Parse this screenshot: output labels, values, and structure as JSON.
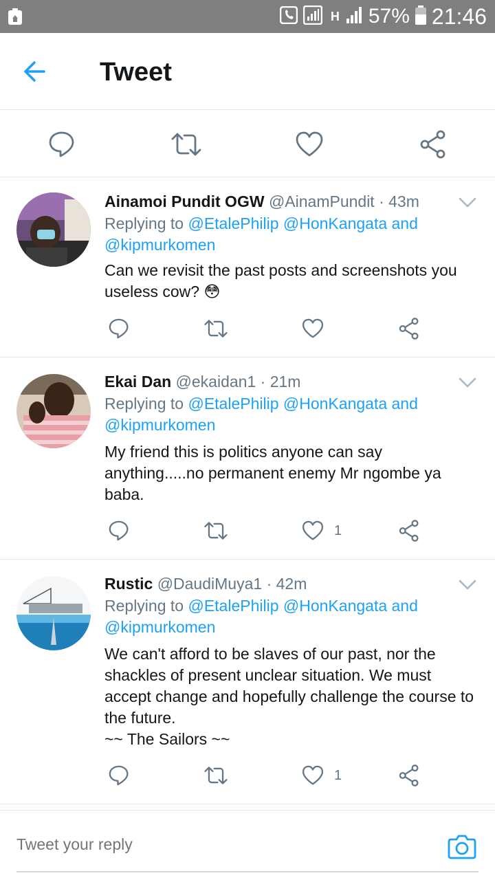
{
  "status_bar": {
    "battery_percent": "57%",
    "time": "21:46",
    "network": "H",
    "icons": [
      "recycle-icon",
      "phone-icon",
      "signal-icon",
      "battery-icon"
    ]
  },
  "header": {
    "title": "Tweet",
    "back_icon": "arrow-left-icon"
  },
  "main_actions": {
    "icons": [
      "reply-icon",
      "retweet-icon",
      "like-icon",
      "share-icon"
    ]
  },
  "replies": [
    {
      "name": "Ainamoi Pundit OGW",
      "handle": "@AinamPundit",
      "time": "· 43m",
      "replying_prefix": "Replying to",
      "mention1": "@EtalePhilip",
      "mention2": "@HonKangata",
      "mention_and": "and",
      "mention3": "@kipmurkomen",
      "text": "Can we revisit the past posts and screenshots you useless cow? 😳",
      "likes": ""
    },
    {
      "name": "Ekai Dan",
      "handle": "@ekaidan1",
      "time": "· 21m",
      "replying_prefix": "Replying to",
      "mention1": "@EtalePhilip",
      "mention2": "@HonKangata",
      "mention_and": "and",
      "mention3": "@kipmurkomen",
      "text": "My friend this is politics anyone can say anything.....no permanent enemy Mr ngombe ya baba.",
      "likes": "1"
    },
    {
      "name": "Rustic",
      "handle": "@DaudiMuya1",
      "time": "· 42m",
      "replying_prefix": "Replying to",
      "mention1": "@EtalePhilip",
      "mention2": "@HonKangata",
      "mention_and": "and",
      "mention3": "@kipmurkomen",
      "text": "We can't afford to be slaves of our past, nor the shackles of present unclear situation. We must accept change and hopefully challenge the course to the future.",
      "signature": "~~ The Sailors ~~",
      "likes": "1"
    }
  ],
  "composer": {
    "placeholder": "Tweet your reply",
    "camera_icon": "camera-icon"
  },
  "colors": {
    "accent": "#1da1f2",
    "text_primary": "#14171a",
    "text_secondary": "#657786",
    "status_bar": "#7f7f7f",
    "divider": "#e1e8ed"
  }
}
